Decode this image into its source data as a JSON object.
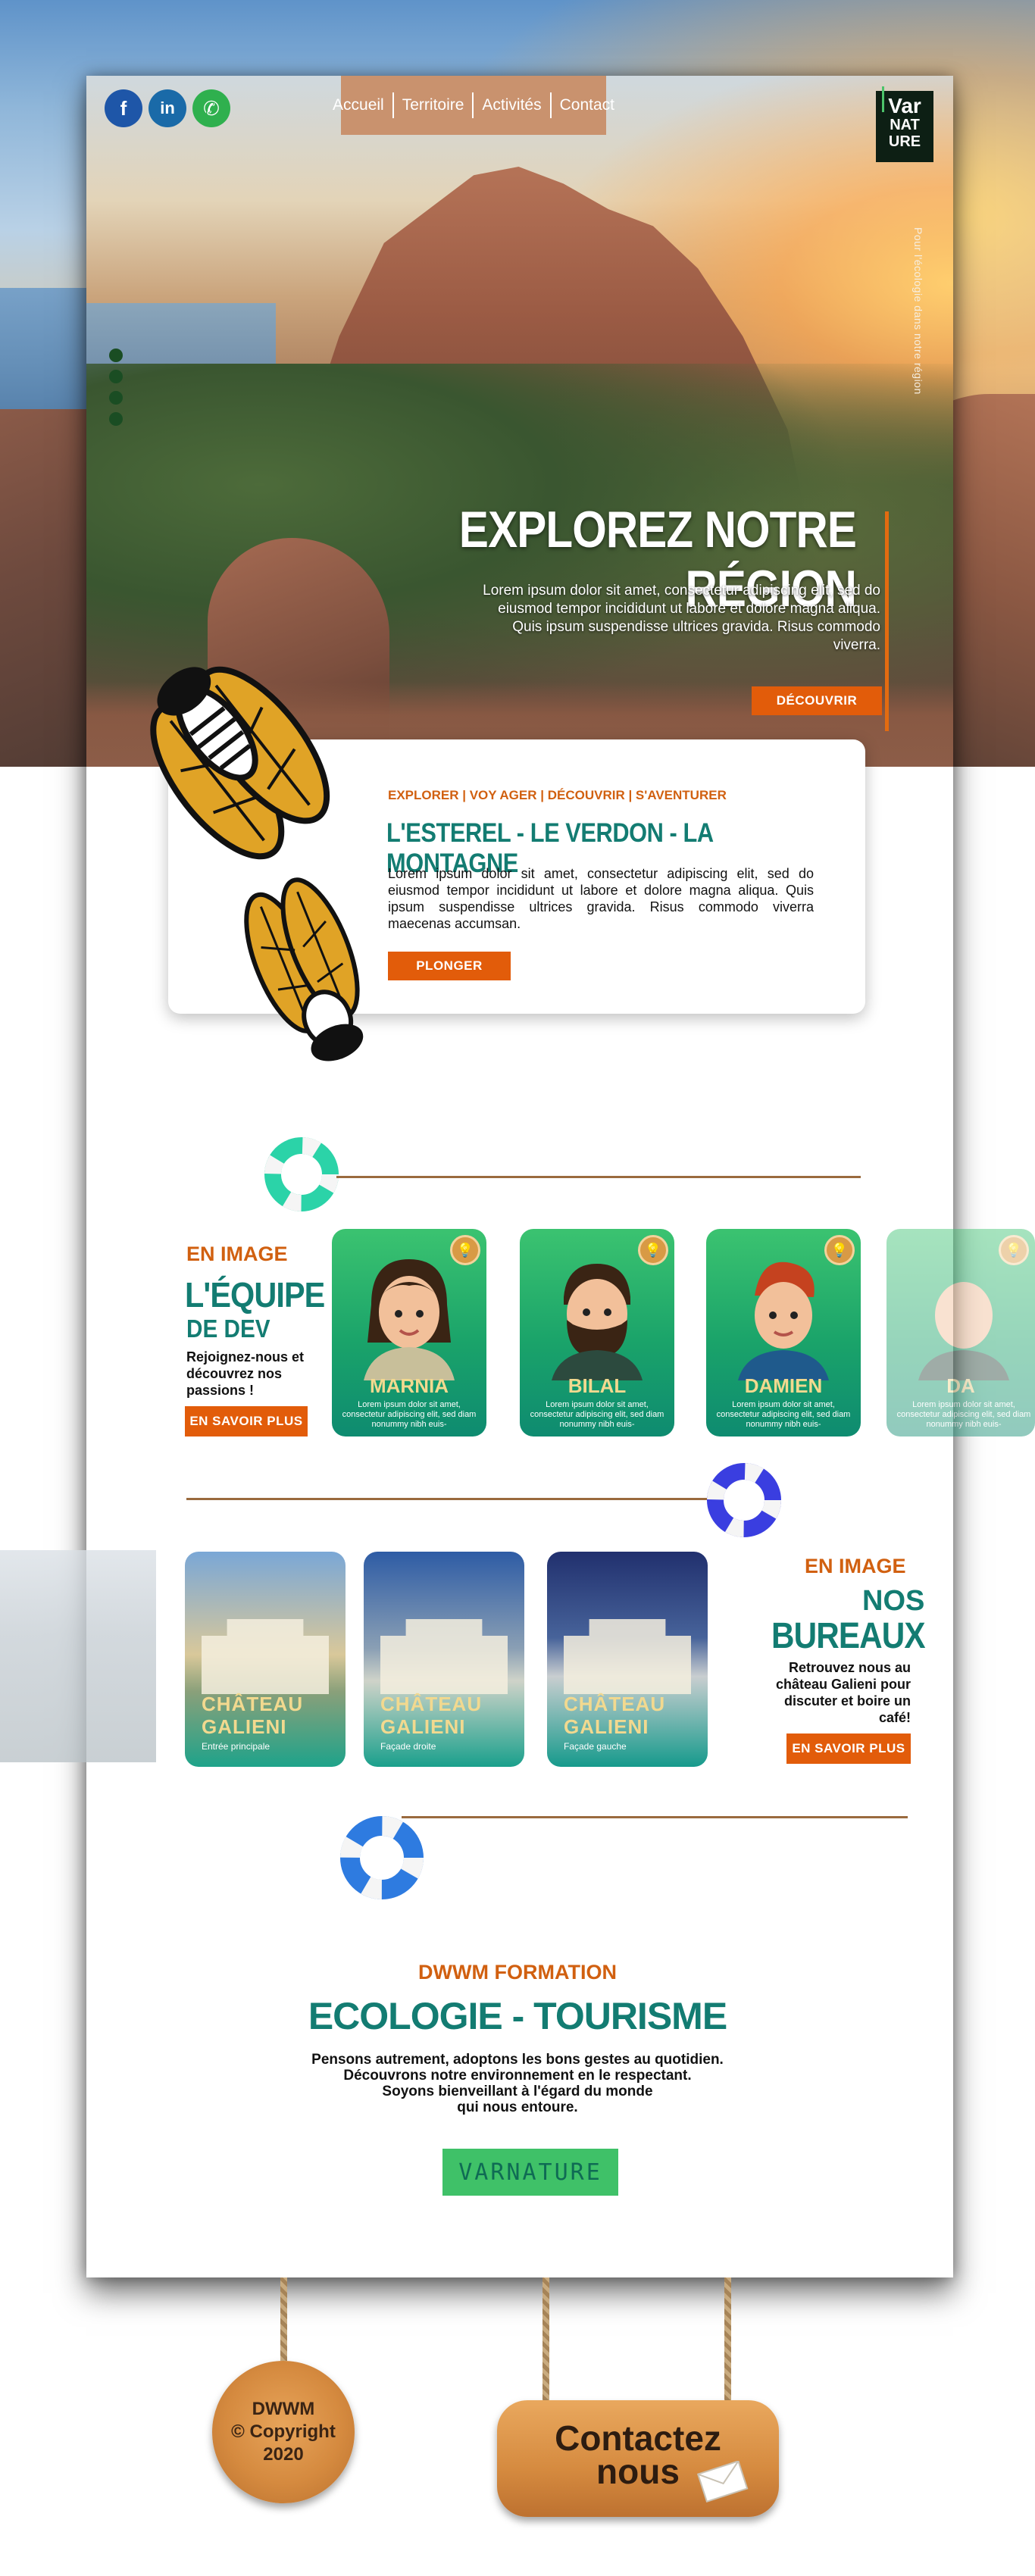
{
  "nav": {
    "items": [
      "Accueil",
      "Territoire",
      "Activités",
      "Contact"
    ]
  },
  "social": {
    "facebook_label": "f",
    "linkedin_label": "in",
    "whatsapp_label": "✆"
  },
  "logo": {
    "line1": "Var",
    "line2": "NAT",
    "line3": "URE"
  },
  "hero": {
    "tagline": "Pour l'écologie dans notre région",
    "title": "EXPLOREZ NOTRE RÉGION",
    "description": "Lorem ipsum dolor sit amet, consectetur adipiscing elit, sed do eiusmod tempor incididunt ut labore et dolore magna aliqua. Quis ipsum suspendisse ultrices gravida. Risus commodo viverra.",
    "cta": "DÉCOUVRIR"
  },
  "explore": {
    "tags": "EXPLORER | VOY AGER | DÉCOUVRIR | S'AVENTURER",
    "title": "L'ESTEREL - LE VERDON - LA MONTAGNE",
    "text": "Lorem ipsum dolor sit amet, consectetur adipiscing elit, sed do eiusmod tempor incididunt ut labore et dolore magna aliqua. Quis ipsum suspendisse ultrices gravida. Risus commodo viverra maecenas accumsan.",
    "cta": "PLONGER"
  },
  "team": {
    "kicker": "EN IMAGE",
    "title": "L'ÉQUIPE",
    "subtitle": "DE DEV",
    "text": "Rejoignez-nous et découvrez nos passions !",
    "cta": "EN SAVOIR PLUS",
    "members": [
      {
        "name": "MARNIA",
        "text": "Lorem ipsum dolor sit amet, consectetur adipiscing elit, sed diam nonummy nibh euis-"
      },
      {
        "name": "BILAL",
        "text": "Lorem ipsum dolor sit amet, consectetur adipiscing elit, sed diam nonummy nibh euis-"
      },
      {
        "name": "DAMIEN",
        "text": "Lorem ipsum dolor sit amet, consectetur adipiscing elit, sed diam nonummy nibh euis-"
      },
      {
        "name": "DA",
        "text": "Lorem ipsum dolor sit amet, consectetur adipiscing elit, sed diam nonummy nibh euis-"
      }
    ]
  },
  "offices": {
    "kicker": "EN IMAGE",
    "title1": "NOS",
    "title2": "BUREAUX",
    "text": "Retrouvez nous au château Galieni pour discuter et boire un café!",
    "cta": "EN SAVOIR PLUS",
    "cards": [
      {
        "title1": "CHÂTEAU",
        "title2": "GALIENI",
        "caption": "Entrée principale"
      },
      {
        "title1": "CHÂTEAU",
        "title2": "GALIENI",
        "caption": "Façade droite"
      },
      {
        "title1": "CHÂTEAU",
        "title2": "GALIENI",
        "caption": "Façade gauche"
      }
    ]
  },
  "formation": {
    "kicker": "DWWM FORMATION",
    "title": "ECOLOGIE - TOURISME",
    "line1": "Pensons autrement, adoptons les bons gestes au quotidien.",
    "line2": "Découvrons notre environnement en le respectant.",
    "line3": "Soyons bienveillant à l'égard du monde",
    "line4": "qui nous entoure.",
    "badge": "VARNATURE"
  },
  "footer": {
    "copyright_line1": "DWWM",
    "copyright_line2": "© Copyright",
    "copyright_line3": "2020",
    "contact_line1": "Contactez",
    "contact_line2": "nous"
  },
  "colors": {
    "orange": "#e25c0a",
    "teal": "#137c72",
    "nav_bg": "#c9926e",
    "green": "#3fc168"
  }
}
